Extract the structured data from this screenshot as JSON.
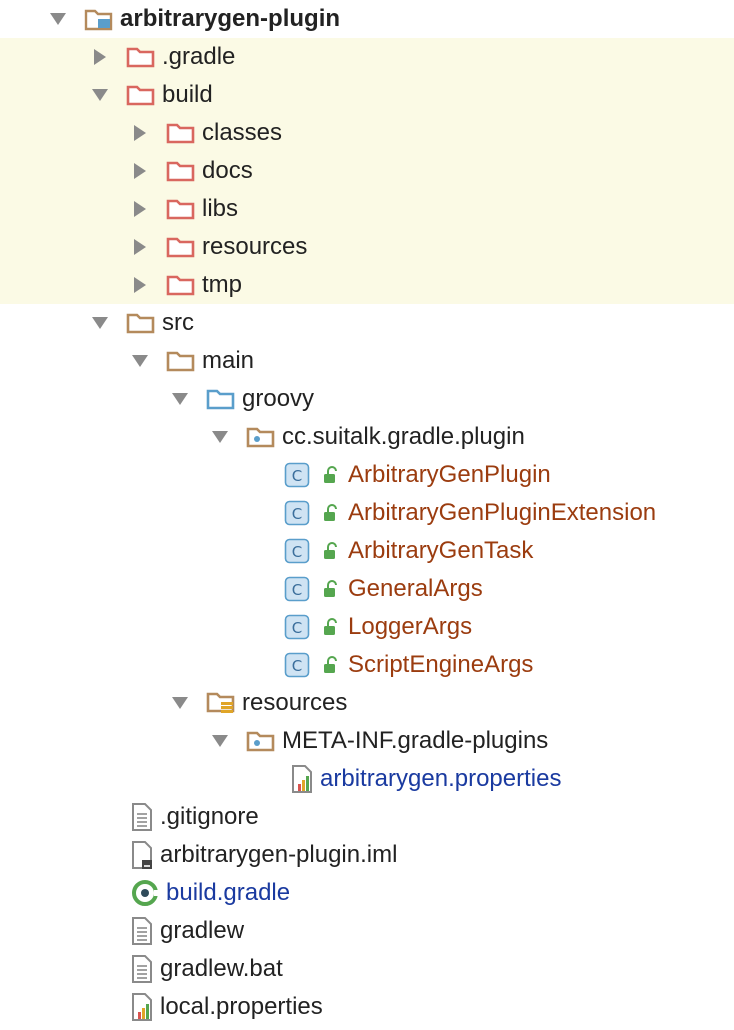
{
  "project_tree": {
    "root": {
      "label": "arbitrarygen-plugin",
      "icon": "module-folder-icon",
      "expanded": true
    },
    "items": [
      {
        "label": ".gradle",
        "icon": "excluded-folder-icon",
        "expanded": false,
        "excluded": true
      },
      {
        "label": "build",
        "icon": "excluded-folder-icon",
        "expanded": true,
        "excluded": true
      },
      {
        "label": "classes",
        "icon": "excluded-folder-icon",
        "expanded": false,
        "excluded": true
      },
      {
        "label": "docs",
        "icon": "excluded-folder-icon",
        "expanded": false,
        "excluded": true
      },
      {
        "label": "libs",
        "icon": "excluded-folder-icon",
        "expanded": false,
        "excluded": true
      },
      {
        "label": "resources",
        "icon": "excluded-folder-icon",
        "expanded": false,
        "excluded": true
      },
      {
        "label": "tmp",
        "icon": "excluded-folder-icon",
        "expanded": false,
        "excluded": true
      },
      {
        "label": "src",
        "icon": "folder-icon",
        "expanded": true
      },
      {
        "label": "main",
        "icon": "folder-icon",
        "expanded": true
      },
      {
        "label": "groovy",
        "icon": "source-root-folder-icon",
        "expanded": true
      },
      {
        "label": "cc.suitalk.gradle.plugin",
        "icon": "package-icon",
        "expanded": true
      },
      {
        "label": "ArbitraryGenPlugin",
        "icon": "groovy-class-icon"
      },
      {
        "label": "ArbitraryGenPluginExtension",
        "icon": "groovy-class-icon"
      },
      {
        "label": "ArbitraryGenTask",
        "icon": "groovy-class-icon"
      },
      {
        "label": "GeneralArgs",
        "icon": "groovy-class-icon"
      },
      {
        "label": "LoggerArgs",
        "icon": "groovy-class-icon"
      },
      {
        "label": "ScriptEngineArgs",
        "icon": "groovy-class-icon"
      },
      {
        "label": "resources",
        "icon": "resources-root-folder-icon",
        "expanded": true
      },
      {
        "label": "META-INF.gradle-plugins",
        "icon": "package-icon",
        "expanded": true
      },
      {
        "label": "arbitrarygen.properties",
        "icon": "properties-file-icon"
      },
      {
        "label": ".gitignore",
        "icon": "text-file-icon"
      },
      {
        "label": "arbitrarygen-plugin.iml",
        "icon": "iml-file-icon"
      },
      {
        "label": "build.gradle",
        "icon": "gradle-file-icon"
      },
      {
        "label": "gradlew",
        "icon": "text-file-icon"
      },
      {
        "label": "gradlew.bat",
        "icon": "text-file-icon"
      },
      {
        "label": "local.properties",
        "icon": "properties-file-icon"
      }
    ]
  },
  "colors": {
    "excluded_background": "#fbfae5",
    "excluded_folder": "#d9675f",
    "folder": "#b48a5c",
    "source_root_folder": "#5a9ecb",
    "class_label": "#9b3c0f",
    "modified_file_label": "#1a3aa0"
  }
}
